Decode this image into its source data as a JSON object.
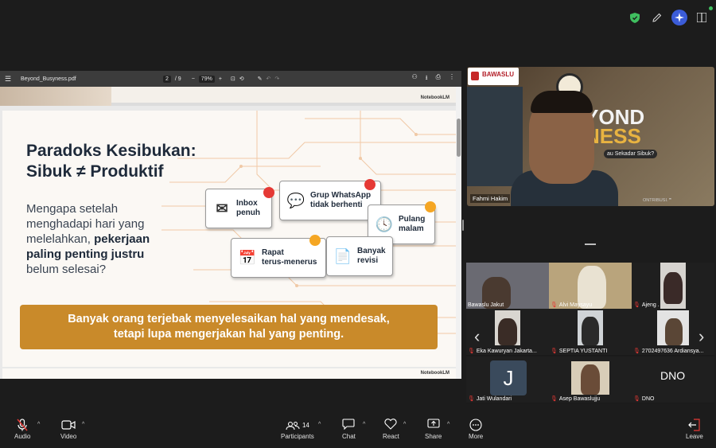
{
  "top_icons": [
    "shield-icon",
    "pen-icon",
    "ai-sparkle-icon",
    "grid-icon"
  ],
  "pdf": {
    "filename": "Beyond_Busyness.pdf",
    "page_current": "2",
    "page_total": "/ 9",
    "zoom": "79%",
    "watermark": "NotebookLM"
  },
  "slide": {
    "title_line1": "Paradoks Kesibukan:",
    "title_line2": "Sibuk ≠ Produktif",
    "sub_plain": "Mengapa setelah menghadapi hari yang melelahkan, ",
    "sub_bold": "pekerjaan paling penting justru",
    "sub_end": " belum selesai?",
    "cards": [
      {
        "label1": "Inbox",
        "label2": "penuh",
        "icon": "envelope-icon"
      },
      {
        "label1": "Grup WhatsApp",
        "label2": "tidak berhenti",
        "icon": "chat-bubble-icon"
      },
      {
        "label1": "Pulang",
        "label2": "malam",
        "icon": "clock-icon"
      },
      {
        "label1": "Rapat",
        "label2": "terus-menerus",
        "icon": "calendar-icon"
      },
      {
        "label1": "Banyak",
        "label2": "revisi",
        "icon": "document-gear-icon"
      }
    ],
    "banner_line1": "Banyak orang terjebak menyelesaikan hal yang mendesak,",
    "banner_line2": "tetapi lupa mengerjakan hal yang penting."
  },
  "speaker": {
    "logo_text": "BAWASLU",
    "name": "Fahmi Hakim",
    "title_part1": "YOND",
    "title_part2": "NESS",
    "question": "au Sekadar Sibuk?",
    "footer": "ONTRIBUSI. ❞"
  },
  "gallery": [
    {
      "name": "Bawaslu Jakut",
      "muted": false
    },
    {
      "name": "Alvi Maysayu",
      "muted": true
    },
    {
      "name": "Ajeng .",
      "muted": true
    },
    {
      "name": "Eka Kawuryan Jakarta...",
      "muted": true
    },
    {
      "name": "SEPTIA YUSTANTI",
      "muted": true
    },
    {
      "name": "2702497636 Ardiansya...",
      "muted": true
    },
    {
      "name": "Jati Wulandari",
      "muted": true,
      "initial": "J"
    },
    {
      "name": "Asep Bawaslujju",
      "muted": true
    },
    {
      "name": "DNO",
      "muted": true,
      "display_text": "DNO"
    }
  ],
  "toolbar": {
    "audio": "Audio",
    "video": "Video",
    "participants": "Participants",
    "participants_count": "14",
    "chat": "Chat",
    "react": "React",
    "share": "Share",
    "more": "More",
    "leave": "Leave"
  }
}
